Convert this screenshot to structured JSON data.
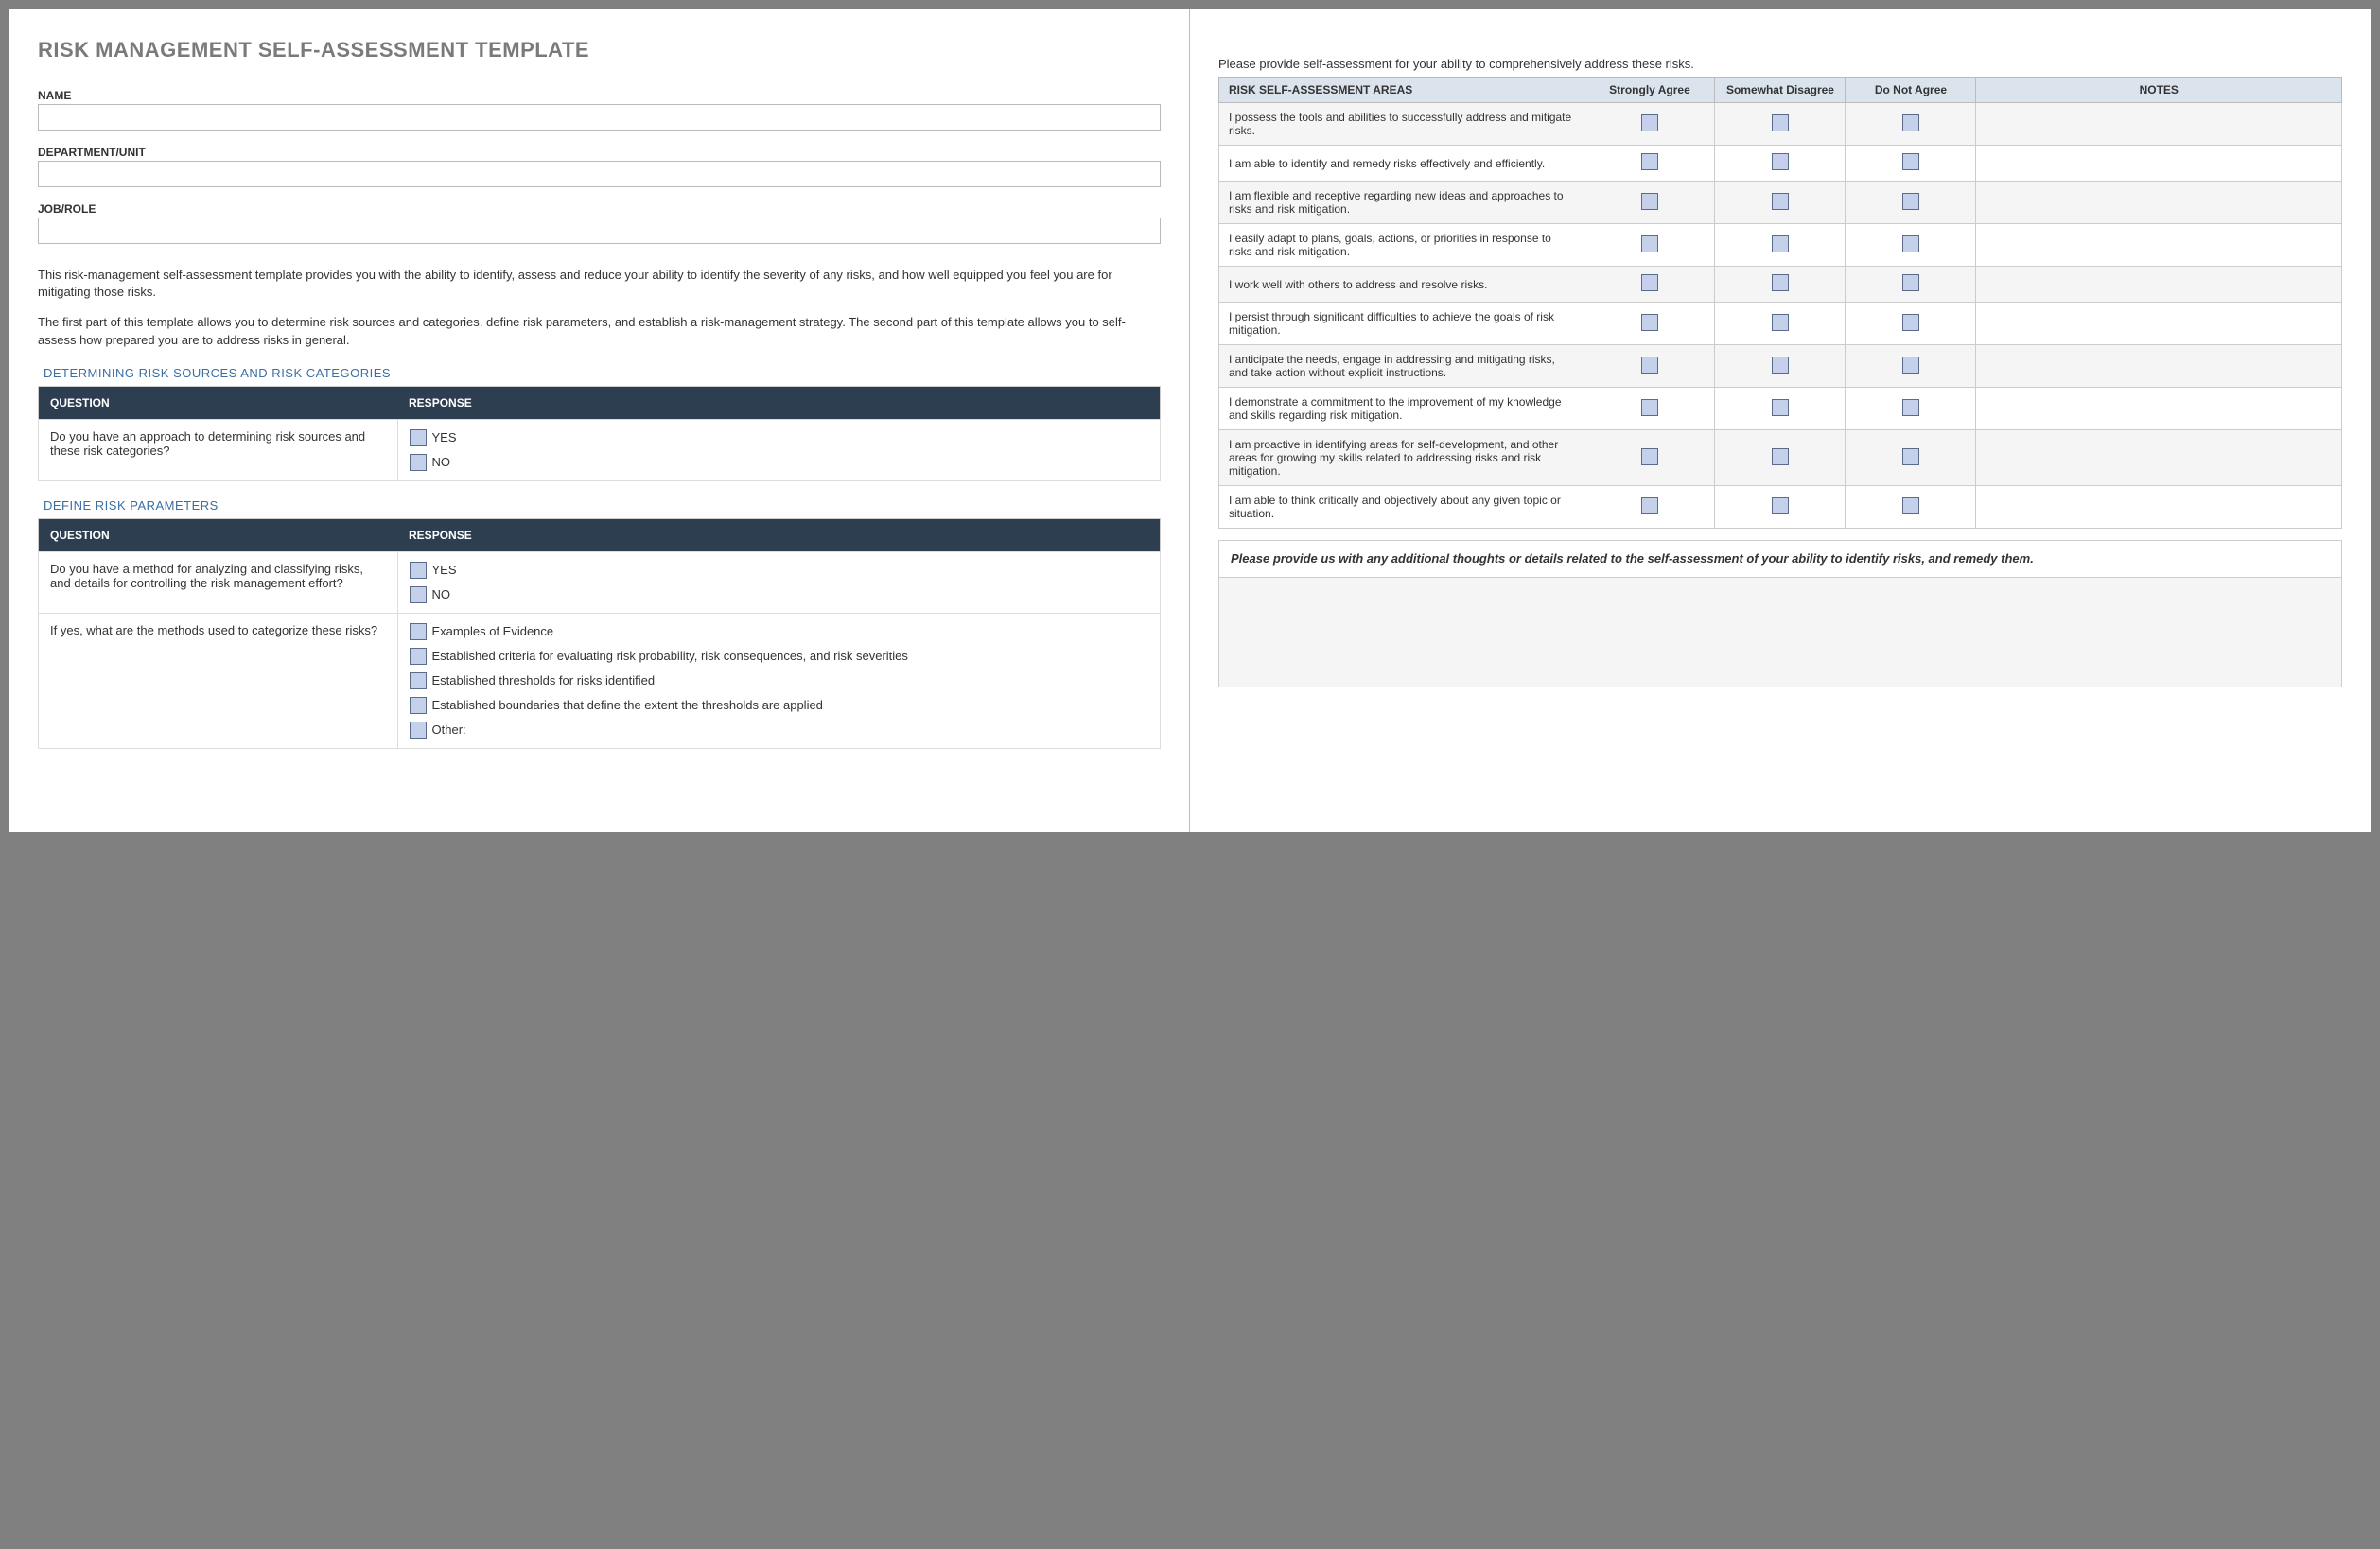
{
  "title": "RISK MANAGEMENT SELF-ASSESSMENT TEMPLATE",
  "fields": {
    "name_label": "NAME",
    "department_label": "DEPARTMENT/UNIT",
    "job_label": "JOB/ROLE"
  },
  "intro": {
    "p1": "This risk-management self-assessment template provides you with the ability to identify, assess and reduce your ability to identify the severity of any risks, and how well equipped you feel you are for mitigating those risks.",
    "p2": "The first part of this template allows you to determine risk sources and categories, define risk parameters, and establish a risk-management strategy. The second part of this template allows you to self-assess how prepared you are to address risks in general."
  },
  "section1": {
    "title": "DETERMINING RISK SOURCES AND RISK CATEGORIES",
    "headers": {
      "q": "QUESTION",
      "r": "RESPONSE"
    },
    "question": "Do you have an approach to determining risk sources and these risk categories?",
    "yes": "YES",
    "no": "NO"
  },
  "section2": {
    "title": "DEFINE RISK PARAMETERS",
    "headers": {
      "q": "QUESTION",
      "r": "RESPONSE"
    },
    "q1": "Do you have a method for analyzing and classifying risks, and details for controlling the risk management effort?",
    "yes": "YES",
    "no": "NO",
    "q2": "If yes, what are the methods used to categorize these risks?",
    "opts": [
      "Examples of Evidence",
      "Established criteria for evaluating risk probability, risk consequences, and risk severities",
      "Established thresholds for risks identified",
      "Established boundaries that define the extent the thresholds are applied",
      "Other:"
    ]
  },
  "right": {
    "instruction": "Please provide self-assessment for your ability to comprehensively address these risks.",
    "headers": {
      "areas": "RISK SELF-ASSESSMENT AREAS",
      "sa": "Strongly Agree",
      "sd": "Somewhat Disagree",
      "dna": "Do Not Agree",
      "notes": "NOTES"
    },
    "rows": [
      "I possess the tools and abilities to successfully address and mitigate risks.",
      "I am able to identify and remedy risks effectively and efficiently.",
      "I am flexible and receptive regarding new ideas and approaches to risks and risk mitigation.",
      "I easily adapt to plans, goals, actions, or priorities in response to risks and risk mitigation.",
      "I work well with others to address and resolve risks.",
      "I persist through significant difficulties to achieve the goals of risk mitigation.",
      "I anticipate the needs, engage in addressing and mitigating risks, and take action without explicit instructions.",
      "I demonstrate a commitment to the improvement of my knowledge and skills regarding risk mitigation.",
      "I am proactive in identifying areas for self-development, and other areas for growing my skills related to addressing risks and risk mitigation.",
      "I am able to think critically and objectively about any given topic or situation."
    ],
    "additional_prompt": "Please provide us with any additional thoughts or details related to the self-assessment of your ability to identify risks, and remedy them."
  }
}
